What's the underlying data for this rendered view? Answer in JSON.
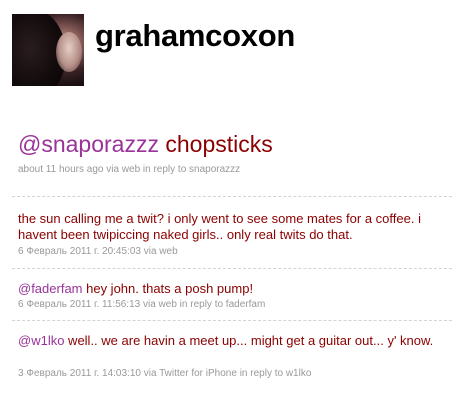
{
  "profile": {
    "username": "grahamcoxon"
  },
  "status": {
    "mention": "@snaporazzz",
    "text": " chopsticks",
    "meta": "about 11 hours ago via web in reply to snaporazzz"
  },
  "tweets": [
    {
      "mention": "",
      "text": "the sun calling me a twit? i only went to see some mates for a coffee. i havent been twipiccing naked girls.. only real twits do that.",
      "meta": "6 Февраль 2011 г. 20:45:03 via web"
    },
    {
      "mention": "@faderfam",
      "text": " hey john. thats a posh pump!",
      "meta": "6 Февраль 2011 г. 11:56:13 via web in reply to faderfam"
    },
    {
      "mention": "@w1lko",
      "text": " well.. we are havin a meet up... might get a guitar out... y' know.",
      "meta": "3 Февраль 2011 г. 14:03:10 via Twitter for iPhone in reply to w1lko"
    }
  ]
}
